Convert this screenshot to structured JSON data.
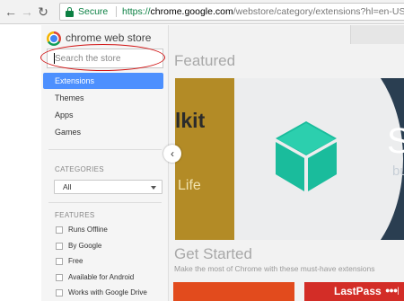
{
  "browser": {
    "back_icon": "back-arrow-icon",
    "forward_icon": "forward-arrow-icon",
    "reload_icon": "reload-icon",
    "secure_label": "Secure",
    "url_scheme": "https://",
    "url_host": "chrome.google.com",
    "url_path": "/webstore/category/extensions?hl=en-US"
  },
  "store": {
    "title": "chrome web store",
    "search_placeholder": "Search the store"
  },
  "nav": {
    "items": [
      {
        "label": "Extensions",
        "active": true
      },
      {
        "label": "Themes",
        "active": false
      },
      {
        "label": "Apps",
        "active": false
      },
      {
        "label": "Games",
        "active": false
      }
    ]
  },
  "categories": {
    "heading": "CATEGORIES",
    "selected": "All"
  },
  "features": {
    "heading": "FEATURES",
    "options": [
      {
        "label": "Runs Offline",
        "checked": false
      },
      {
        "label": "By Google",
        "checked": false
      },
      {
        "label": "Free",
        "checked": false
      },
      {
        "label": "Available for Android",
        "checked": false
      },
      {
        "label": "Works with Google Drive",
        "checked": false
      }
    ]
  },
  "main": {
    "featured_title": "Featured",
    "banner": {
      "left_text": "lkit",
      "left_subtext": "Life",
      "right_text": "S",
      "right_subtext": "bu"
    },
    "get_started_title": "Get Started",
    "get_started_subtitle": "Make the most of Chrome with these must-have extensions",
    "tiles": [
      {
        "label": ""
      },
      {
        "label": "LastPass",
        "suffix": "●●●|"
      }
    ]
  },
  "colors": {
    "accent": "#4d90fe",
    "secure_green": "#0b8043",
    "annotation_red": "#d11414",
    "banner_gold": "#b38b26",
    "banner_dark": "#2a3e51",
    "cube_teal": "#1abc9c",
    "tile_orange": "#e24b1d",
    "tile_red": "#d32d27"
  }
}
